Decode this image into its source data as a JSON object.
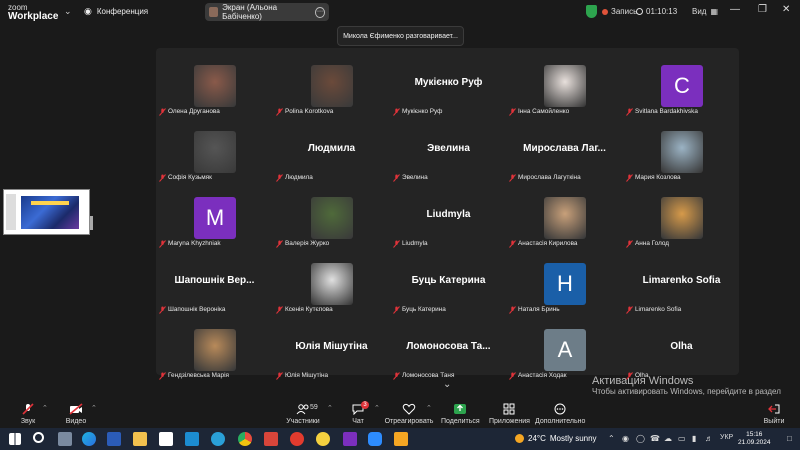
{
  "topbar": {
    "brand_line1": "zoom",
    "brand_line2": "Workplace",
    "meeting_label": "Конференция",
    "screen_label": "Экран (Альона Бабіченко)",
    "record_label": "Запись",
    "timer": "01:10:13",
    "view_label": "Вид"
  },
  "toast": "Микола Єфименко разговаривает...",
  "participants": [
    {
      "label": "Олена Друганова",
      "big": "",
      "initial": "",
      "color": "#8a5a4a"
    },
    {
      "label": "Polina Korotkova",
      "big": "",
      "initial": "",
      "color": "#6b4a3a"
    },
    {
      "label": "Мукієнко Руф",
      "big": "Мукієнко Руф",
      "initial": "",
      "color": ""
    },
    {
      "label": "Інна Самойленко",
      "big": "",
      "initial": "",
      "color": "#e8e0dc"
    },
    {
      "label": "Svitlana Bardakhivska",
      "big": "",
      "initial": "C",
      "color": "#7b2fbe"
    },
    {
      "label": "Софія Кузьмяк",
      "big": "",
      "initial": "",
      "color": "#555555"
    },
    {
      "label": "Людмила",
      "big": "Людмила",
      "initial": "",
      "color": ""
    },
    {
      "label": "Эвелина",
      "big": "Эвелина",
      "initial": "",
      "color": ""
    },
    {
      "label": "Мирослава Лагуткіна",
      "big": "Мирослава Лаг...",
      "initial": "",
      "color": ""
    },
    {
      "label": "Мария Козлова",
      "big": "",
      "initial": "",
      "color": "#9bb3c4"
    },
    {
      "label": "Maryna Khyzhniak",
      "big": "",
      "initial": "M",
      "color": "#7b2fbe"
    },
    {
      "label": "Валерія Журко",
      "big": "",
      "initial": "",
      "color": "#4f6a3a"
    },
    {
      "label": "Liudmyla",
      "big": "Liudmyla",
      "initial": "",
      "color": ""
    },
    {
      "label": "Анастасія Кирилова",
      "big": "",
      "initial": "",
      "color": "#c8a07a"
    },
    {
      "label": "Анна Голод",
      "big": "",
      "initial": "",
      "color": "#d69a4a"
    },
    {
      "label": "Шапошнік Вероніка",
      "big": "Шапошнік Вер...",
      "initial": "",
      "color": ""
    },
    {
      "label": "Ксенія Кутєпова",
      "big": "",
      "initial": "",
      "color": "#e0e0e0"
    },
    {
      "label": "Буць Катерина",
      "big": "Буць Катерина",
      "initial": "",
      "color": ""
    },
    {
      "label": "Наталя Бринь",
      "big": "",
      "initial": "H",
      "color": "#1a5fa8"
    },
    {
      "label": "Limarenko Sofia",
      "big": "Limarenko Sofia",
      "initial": "",
      "color": ""
    },
    {
      "label": "Гендзілевська Марія",
      "big": "",
      "initial": "",
      "color": "#b88a5a"
    },
    {
      "label": "Юлія Мішутіна",
      "big": "Юлія Мішутіна",
      "initial": "",
      "color": ""
    },
    {
      "label": "Ломоносова Таня",
      "big": "Ломоносова Та...",
      "initial": "",
      "color": ""
    },
    {
      "label": "Анастасія Ходак",
      "big": "",
      "initial": "A",
      "color": "#6d7d88"
    },
    {
      "label": "Olha",
      "big": "Olha",
      "initial": "",
      "color": ""
    }
  ],
  "activation": {
    "title": "Активация Windows",
    "text": "Чтобы активировать Windows, перейдите в раздел \"Параметры\"."
  },
  "toolbar": {
    "audio": "Звук",
    "video": "Видео",
    "participants": "Участники",
    "participants_count": "59",
    "chat": "Чат",
    "chat_badge": "3",
    "react": "Отреагировать",
    "share": "Поделиться",
    "apps": "Приложения",
    "more": "Дополнительно",
    "leave": "Выйти"
  },
  "taskbar": {
    "weather_temp": "24°C",
    "weather_text": "Mostly sunny",
    "lang": "УКР",
    "time": "15:16",
    "date": "21.09.2024"
  },
  "colors": {
    "mic_muted": "#e0333a",
    "accent_green": "#2da44e",
    "purple_avatar": "#7b2fbe",
    "blue_avatar": "#1a5fa8"
  }
}
